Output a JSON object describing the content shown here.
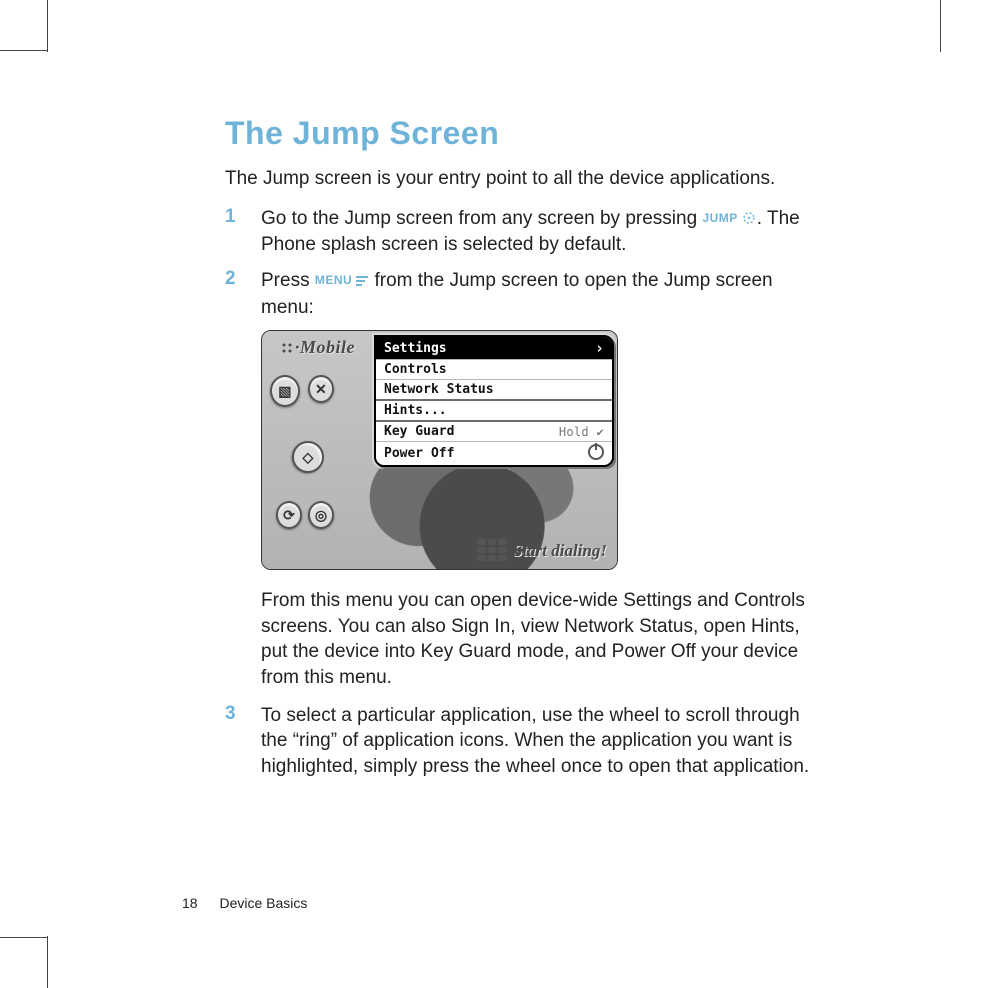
{
  "title": "The Jump Screen",
  "intro": "The Jump screen is your entry point to all the device applications.",
  "steps": [
    {
      "num": "1",
      "pre": "Go to the Jump screen from any screen by pressing ",
      "key_label": "JUMP",
      "post": ". The Phone splash screen is selected by default."
    },
    {
      "num": "2",
      "pre": "Press ",
      "key_label": "MENU",
      "post": " from the Jump screen to open the Jump screen menu:"
    },
    {
      "num": "3",
      "pre": "To select a particular application, use the wheel to scroll through the “ring” of application icons. When the application you want is highlighted, simply press the wheel once to open that application.",
      "key_label": "",
      "post": ""
    }
  ],
  "after_fig_para": "From this menu you can open device-wide Settings and Controls screens. You can also Sign In, view Network Status, open Hints, put the device into Key Guard mode, and Power Off your device from this menu.",
  "shot": {
    "carrier": "·Mobile",
    "menu": {
      "items": [
        {
          "label": "Settings",
          "selected": true,
          "note": ""
        },
        {
          "label": "Controls",
          "selected": false,
          "note": ""
        },
        {
          "label": "Network Status",
          "selected": false,
          "note": ""
        },
        {
          "label": "Hints...",
          "selected": false,
          "note": "",
          "sep": true
        },
        {
          "label": "Key Guard",
          "selected": false,
          "note": "Hold ✔",
          "sep": true
        },
        {
          "label": "Power Off",
          "selected": false,
          "note": "power"
        }
      ]
    },
    "prompt": "Start dialing!"
  },
  "footer": {
    "page_number": "18",
    "section": "Device Basics"
  }
}
